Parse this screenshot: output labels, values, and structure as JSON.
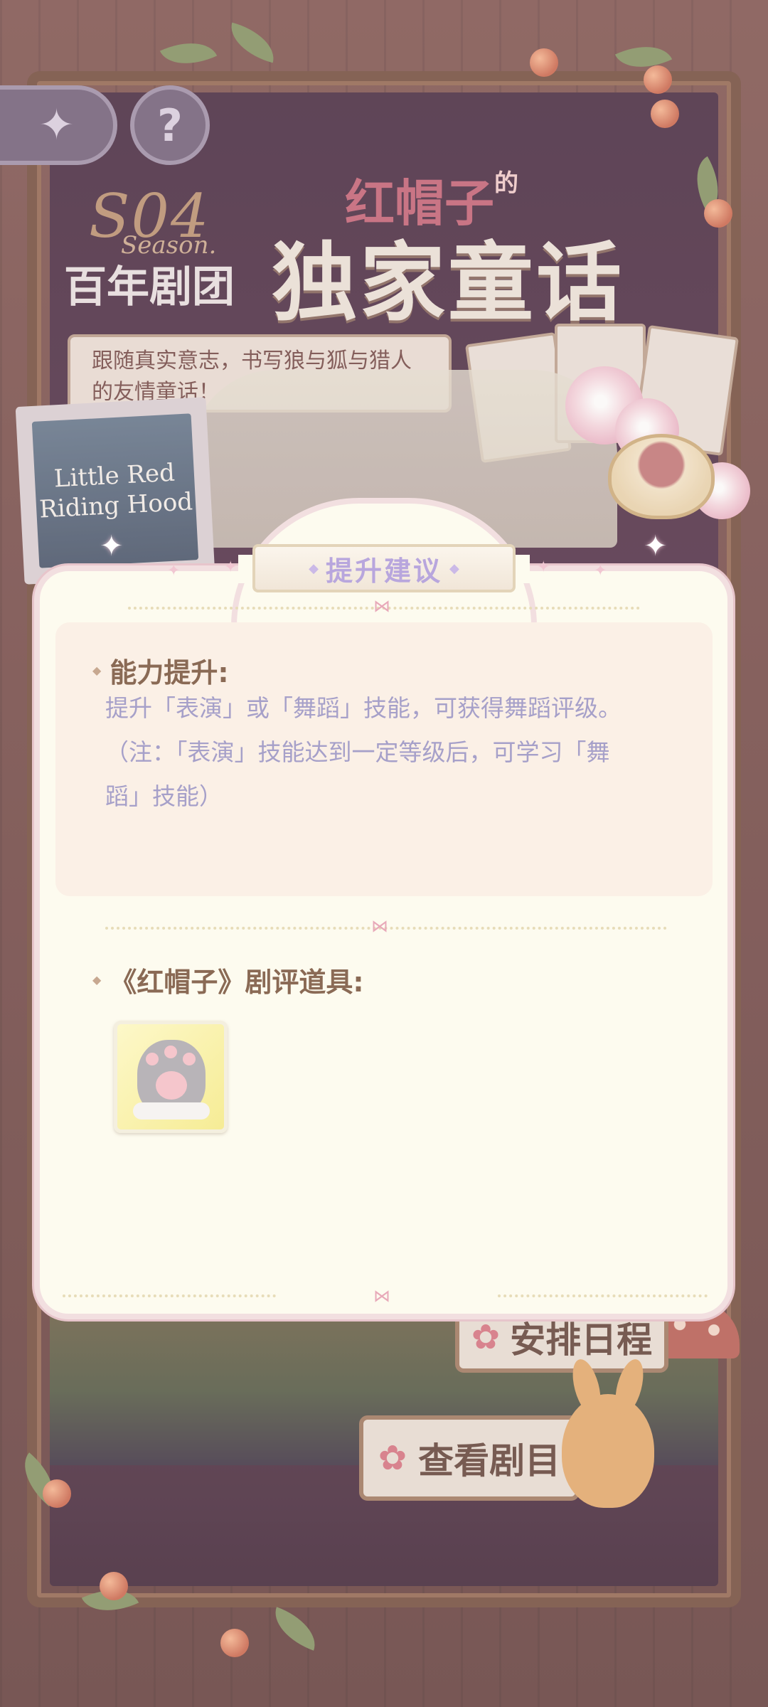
{
  "background": {
    "season_number": "S04",
    "season_word": "Season.",
    "season_subtitle": "百年剧团",
    "title_small": "红帽子",
    "title_small_suffix": "的",
    "title_big": "独家童话",
    "description": "跟随真实意志，书写狼与狐与猎人的友情童话！",
    "ticket_text": "Little Red Riding Hood",
    "star_icon": "four-point-star-icon",
    "help_glyph": "?",
    "schedule_button": "安排日程",
    "view_button": "查看剧目"
  },
  "modal": {
    "title": "提升建议",
    "section1": {
      "heading": "能力提升:",
      "lines": [
        "提升「表演」或「舞蹈」技能，可获得舞蹈评级。",
        "（注：「表演」技能达到一定等级后，可学习「舞",
        "蹈」技能）"
      ]
    },
    "section2": {
      "heading": "《红帽子》剧评道具:",
      "item_icon": "cat-paw-glove-icon"
    }
  },
  "colors": {
    "title_purple": "#b8a6dd",
    "heading_brown": "#8a6a55",
    "body_lavender": "#a6a0c9",
    "modal_bg": "#fdfbef",
    "modal_border": "#f2dfe0"
  }
}
